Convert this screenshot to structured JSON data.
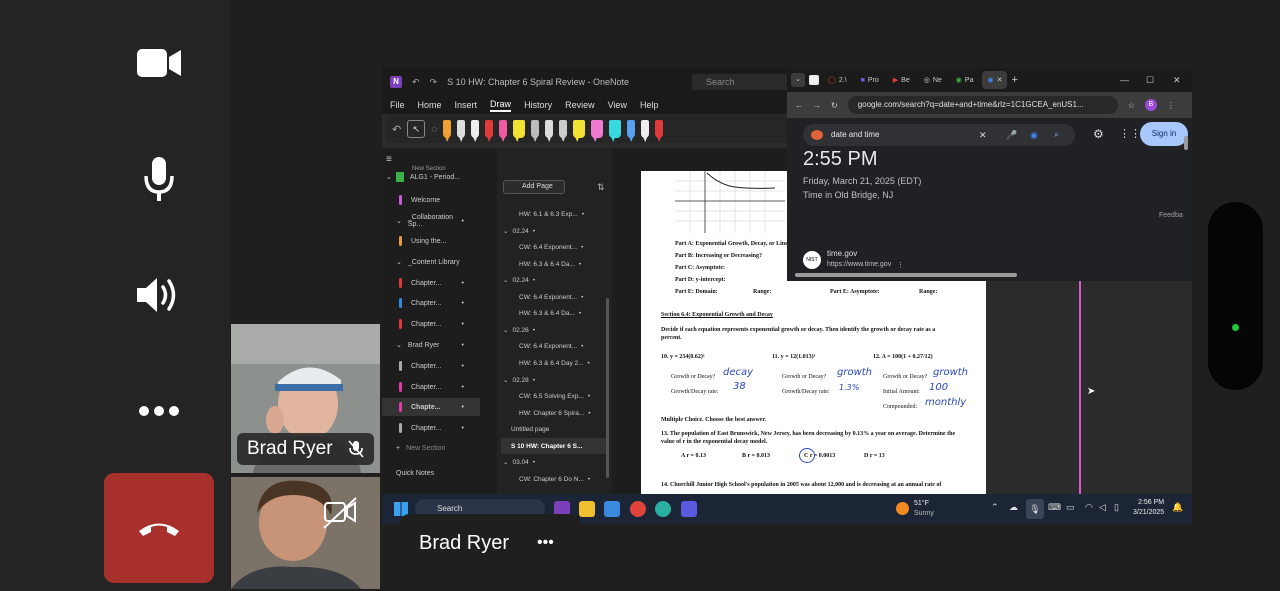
{
  "call": {
    "participant_name": "Brad Ryer",
    "participant_tile_label": "Brad Ryer",
    "more_label": "•••"
  },
  "onenote": {
    "title": "S 10 HW: Chapter 6 Spiral Review - OneNote",
    "search_placeholder": "Search",
    "menu": [
      "File",
      "Home",
      "Insert",
      "Draw",
      "History",
      "Review",
      "View",
      "Help"
    ],
    "active_menu": "Draw",
    "new_section_top": "New Section",
    "notebook": "ALG1 - Period...",
    "sections": [
      {
        "label": "Welcome",
        "color": "#c85ad8"
      },
      {
        "label": "_Collaboration Sp...",
        "color": ""
      },
      {
        "label": "Using the...",
        "color": "#e89b43"
      },
      {
        "label": "_Content Library",
        "color": ""
      },
      {
        "label": "Chapter...",
        "color": "#e03a3a"
      },
      {
        "label": "Chapter...",
        "color": "#2f8ae0"
      },
      {
        "label": "Chapter...",
        "color": "#e03a3a"
      },
      {
        "label": "Brad Ryer",
        "color": ""
      },
      {
        "label": "Chapter...",
        "color": "#aaaaaa"
      },
      {
        "label": "Chapter...",
        "color": "#e03aa8"
      },
      {
        "label": "Chapte...",
        "color": "#e03aa8"
      },
      {
        "label": "Chapter...",
        "color": "#aaaaaa"
      },
      {
        "label": "New Section",
        "color": ""
      },
      {
        "label": "Quick Notes",
        "color": ""
      }
    ],
    "add_page": "Add Page",
    "pages": [
      "HW: 6.1 & 6.3 Exp...",
      "02.24",
      "CW: 6.4 Exponent...",
      "HW: 6.3 & 6.4 Da...",
      "02.24",
      "CW: 6.4 Exponent...",
      "HW: 6.3 & 6.4 Da...",
      "02.26",
      "CW: 6.4 Exponent...",
      "HW: 6.3 & 6.4 Day 2...",
      "02.28",
      "CW: 6.5 Solving Exp...",
      "HW: Chapter 6 Spira...",
      "Untitled page",
      "S 10 HW: Chapter 6 S...",
      "03.04",
      "CW: Chapter 6 Do N..."
    ]
  },
  "worksheet": {
    "part_a": "Part A: Exponential Growth, Decay, or Line",
    "part_b": "Part B: Increasing or Decreasing?",
    "part_c": "Part C: Asymptote:",
    "part_d": "Part D: y-intercept:",
    "part_e": "Part E: Domain:",
    "range": "Range:",
    "part_e2": "Part E: Asymptote:",
    "range2": "Range:",
    "section": "Section 6.4: Exponential Growth and Decay",
    "instructions": "Decide if each equation represents exponential growth or decay.  Then identify the growth or decay rate as a percent.",
    "eq10": "10.  y = 234(0.62)ˣ",
    "eq11": "11.  y = 12(1.013)ˣ",
    "eq12": "12.  A = 100(1 + 0.27/12)",
    "growth_or_decay": "Growth or Decay?",
    "rate": "Growth/Decay rate:",
    "initial": "Initial Amount:",
    "compounded": "Compounded:",
    "mc": "Multiple Choice.  Choose the best answer.",
    "q13": "13.  The population of East Brunswick, New Jersey, has been decreasing by 0.13% a year on average. Determine the value of r in the exponential decay model.",
    "q13_choices": [
      "A  r = 0.13",
      "B  r = 0.013",
      "C  r = 0.0013",
      "D  r = 13"
    ],
    "q14": "14.  Churchill Junior High School's population in 2005 was about 12,000 and is decreasing at an annual rate of",
    "hw_decay": "decay",
    "hw_38": "38",
    "hw_growth1": "growth",
    "hw_13": "1.3%",
    "hw_growth2": "growth",
    "hw_100": "100",
    "hw_monthly": "monthly"
  },
  "chrome": {
    "tabs": [
      "2.\\",
      "Pro",
      "Be",
      "Ne",
      "Pa"
    ],
    "url": "google.com/search?q=date+and+time&rlz=1C1GCEA_enUS1...",
    "query": "date and time",
    "sign_in": "Sign in",
    "time": "2:55 PM",
    "date": "Friday, March 21, 2025 (EDT)",
    "location": "Time in Old Bridge, NJ",
    "feedback": "Feedba",
    "site_name": "time.gov",
    "site_url": "https://www.time.gov",
    "profile_letter": "B"
  },
  "taskbar": {
    "search": "Search",
    "weather_temp": "51°F",
    "weather_desc": "Sunny",
    "time": "2:56 PM",
    "date": "3/21/2025"
  },
  "colors": {
    "end_call": "#a8302c",
    "status_dot": "#1fc93a"
  }
}
